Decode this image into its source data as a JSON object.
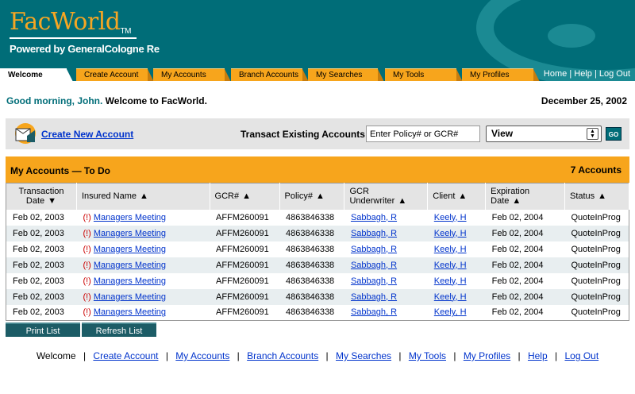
{
  "header": {
    "logo_text": "FacWorld",
    "logo_tm": "TM",
    "powered_by": "Powered by GeneralCologne Re",
    "brand_colors": {
      "teal": "#006d78",
      "orange": "#f7a51c"
    }
  },
  "tabs": [
    {
      "label": "Welcome",
      "active": true
    },
    {
      "label": "Create Account"
    },
    {
      "label": "My Accounts"
    },
    {
      "label": "Branch Accounts"
    },
    {
      "label": "My Searches"
    },
    {
      "label": "My Tools"
    },
    {
      "label": "My Profiles"
    }
  ],
  "toplinks": [
    "Home",
    "Help",
    "Log Out"
  ],
  "greeting": {
    "prefix": "Good morning, John.",
    "suffix": "Welcome to FacWorld."
  },
  "date": "December 25, 2002",
  "actionbar": {
    "create_label": "Create New Account",
    "transact_label": "Transact Existing Accounts:",
    "policy_placeholder": "Enter Policy# or GCR#",
    "view_value": "View",
    "go_label": "GO"
  },
  "panel": {
    "title": "My Accounts — To Do",
    "count": "7 Accounts"
  },
  "columns": [
    {
      "label": "Transaction Date",
      "sort": "▼"
    },
    {
      "label": "Insured Name",
      "sort": "▲"
    },
    {
      "label": "GCR#",
      "sort": "▲"
    },
    {
      "label": "Policy#",
      "sort": "▲"
    },
    {
      "label": "GCR Underwriter",
      "sort": "▲"
    },
    {
      "label": "Client",
      "sort": "▲"
    },
    {
      "label": "Expiration Date",
      "sort": "▲"
    },
    {
      "label": "Status",
      "sort": "▲"
    }
  ],
  "rows": [
    {
      "date": "Feb 02, 2003",
      "flag": "(!)",
      "insured": "Managers Meeting",
      "gcr": "AFFM260091",
      "policy": "4863846338",
      "underwriter": "Sabbagh, R",
      "client": "Keely, H",
      "expiration": "Feb 02, 2004",
      "status": "QuoteInProg"
    },
    {
      "date": "Feb 02, 2003",
      "flag": "(!)",
      "insured": "Managers Meeting",
      "gcr": "AFFM260091",
      "policy": "4863846338",
      "underwriter": "Sabbagh, R",
      "client": "Keely, H",
      "expiration": "Feb 02, 2004",
      "status": "QuoteInProg"
    },
    {
      "date": "Feb 02, 2003",
      "flag": "(!)",
      "insured": "Managers Meeting",
      "gcr": "AFFM260091",
      "policy": "4863846338",
      "underwriter": "Sabbagh, R",
      "client": "Keely, H",
      "expiration": "Feb 02, 2004",
      "status": "QuoteInProg"
    },
    {
      "date": "Feb 02, 2003",
      "flag": "(!)",
      "insured": "Managers Meeting",
      "gcr": "AFFM260091",
      "policy": "4863846338",
      "underwriter": "Sabbagh, R",
      "client": "Keely, H",
      "expiration": "Feb 02, 2004",
      "status": "QuoteInProg"
    },
    {
      "date": "Feb 02, 2003",
      "flag": "(!)",
      "insured": "Managers Meeting",
      "gcr": "AFFM260091",
      "policy": "4863846338",
      "underwriter": "Sabbagh, R",
      "client": "Keely, H",
      "expiration": "Feb 02, 2004",
      "status": "QuoteInProg"
    },
    {
      "date": "Feb 02, 2003",
      "flag": "(!)",
      "insured": "Managers Meeting",
      "gcr": "AFFM260091",
      "policy": "4863846338",
      "underwriter": "Sabbagh, R",
      "client": "Keely, H",
      "expiration": "Feb 02, 2004",
      "status": "QuoteInProg"
    },
    {
      "date": "Feb 02, 2003",
      "flag": "(!)",
      "insured": "Managers Meeting",
      "gcr": "AFFM260091",
      "policy": "4863846338",
      "underwriter": "Sabbagh, R",
      "client": "Keely, H",
      "expiration": "Feb 02, 2004",
      "status": "QuoteInProg"
    }
  ],
  "buttons": {
    "print": "Print List",
    "refresh": "Refresh List"
  },
  "footer": {
    "welcome": "Welcome",
    "links": [
      "Create Account",
      "My Accounts",
      "Branch Accounts",
      "My Searches",
      "My Tools",
      "My Profiles",
      "Help",
      "Log Out"
    ]
  }
}
